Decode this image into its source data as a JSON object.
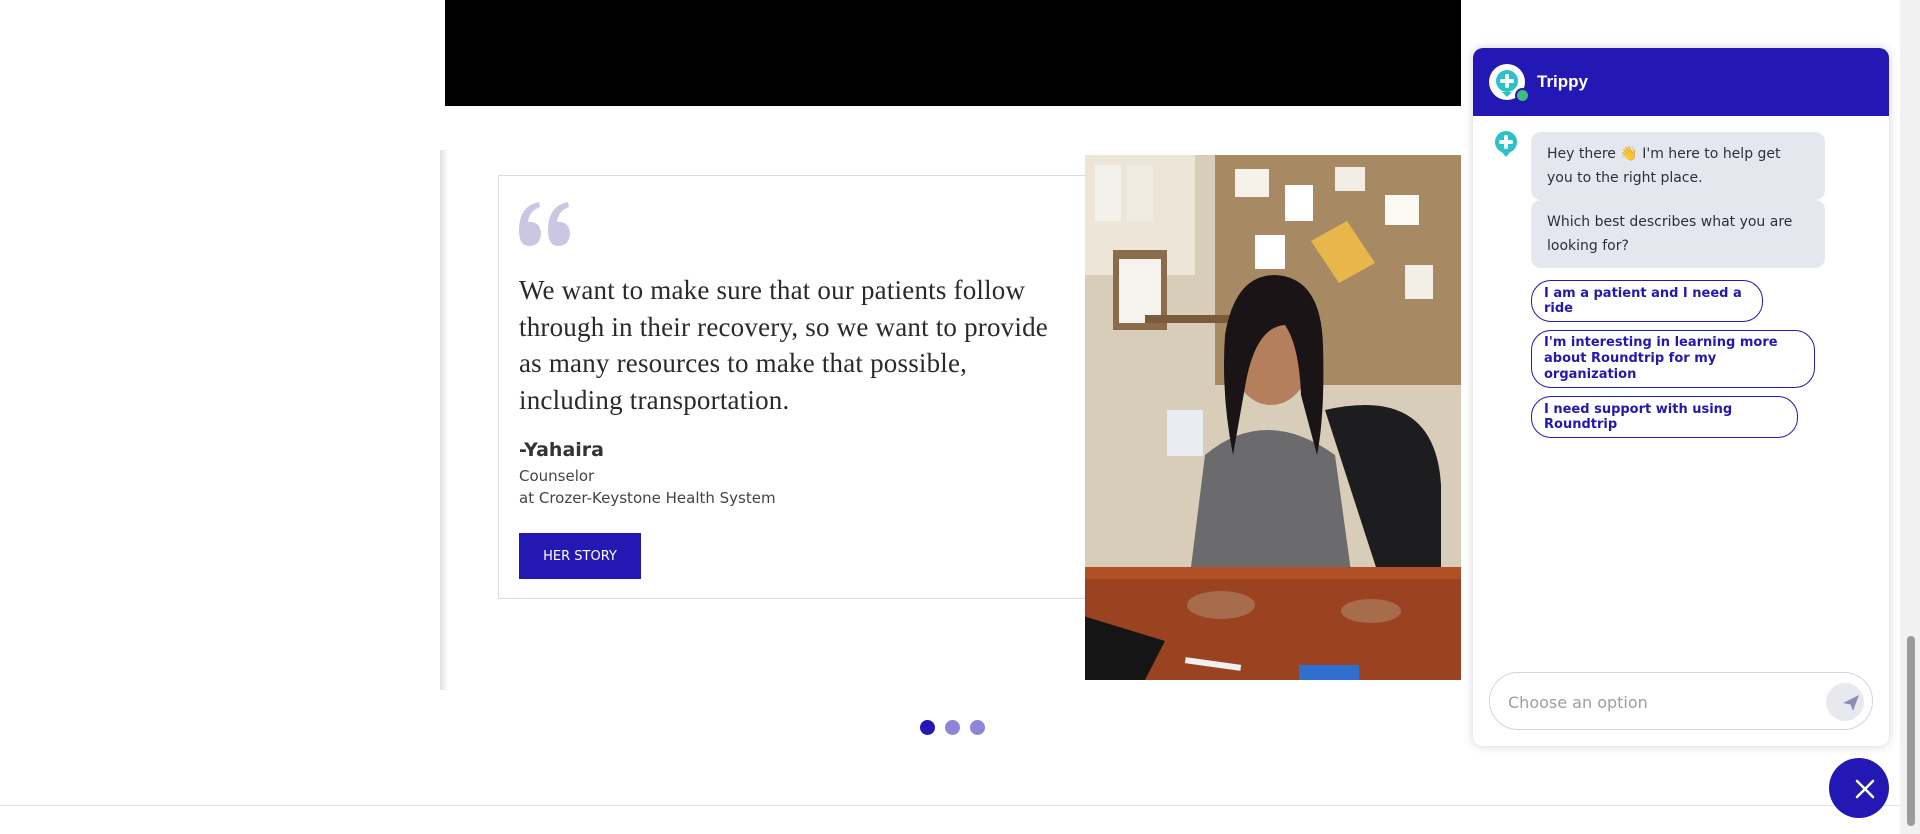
{
  "testimonial": {
    "quote": "We want to make sure that our patients follow through in their recovery, so we want to provide as many resources to make that possible, including transportation.",
    "author": "-Yahaira",
    "role": "Counselor",
    "organization": "at Crozer-Keystone Health System",
    "button_label": "HER STORY"
  },
  "carousel": {
    "slide_count": 3,
    "active_index": 0
  },
  "chat": {
    "bot_name": "Trippy",
    "messages": [
      "Hey there 👋 I'm here to help get you to the right place.",
      "Which best describes what you are looking for?"
    ],
    "options": [
      "I am a patient and I need a ride",
      "I'm interesting in learning more about Roundtrip for my organization",
      "I need support with using Roundtrip"
    ],
    "input_placeholder": "Choose an option"
  },
  "colors": {
    "brand": "#2418b4",
    "dot_inactive": "#8d86d8",
    "bubble_bg": "#e4e8ee",
    "bot_icon": "#28c2c8",
    "online": "#3dbe7a"
  },
  "icons": {
    "quote_mark": "quote-icon",
    "bot_avatar": "medical-cross-icon",
    "send": "send-icon",
    "close": "close-icon"
  }
}
